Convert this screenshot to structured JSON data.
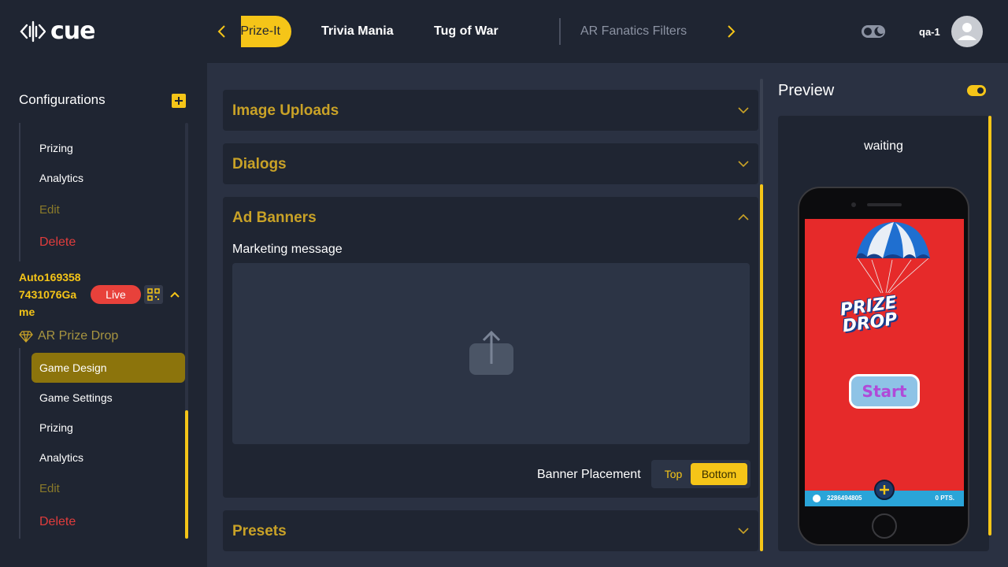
{
  "header": {
    "logo_text": "cue",
    "tabs": [
      {
        "label": "Prize-It",
        "active": true
      },
      {
        "label": "Trivia Mania"
      },
      {
        "label": "Tug of War"
      },
      {
        "label": "AR Fanatics Filters",
        "muted": true
      }
    ],
    "user": "qa-1"
  },
  "sidebar": {
    "title": "Configurations",
    "prev_items": [
      "Prizing",
      "Analytics",
      "Edit",
      "Delete"
    ],
    "game": {
      "name_lines": [
        "Auto169358",
        "7431076Ga",
        "me"
      ],
      "status": "Live"
    },
    "game_type": "AR Prize Drop",
    "items": [
      "Game Design",
      "Game Settings",
      "Prizing",
      "Analytics",
      "Edit",
      "Delete"
    ]
  },
  "main": {
    "panels": [
      {
        "title": "Image Uploads"
      },
      {
        "title": "Dialogs"
      },
      {
        "title": "Ad Banners",
        "field_label": "Marketing message",
        "placement_label": "Banner Placement",
        "options": [
          "Top",
          "Bottom"
        ],
        "selected": "Bottom"
      },
      {
        "title": "Presets"
      }
    ]
  },
  "preview": {
    "title": "Preview",
    "status": "waiting",
    "game_title_lines": [
      "PRIZE",
      "DROP"
    ],
    "start_label": "Start",
    "user_id": "2286494805",
    "points": "0 PTS."
  },
  "colors": {
    "accent": "#f5c518",
    "danger": "#e03c3c",
    "live": "#e8413b",
    "panel": "#1f2532",
    "content_bg": "#2a3142"
  }
}
